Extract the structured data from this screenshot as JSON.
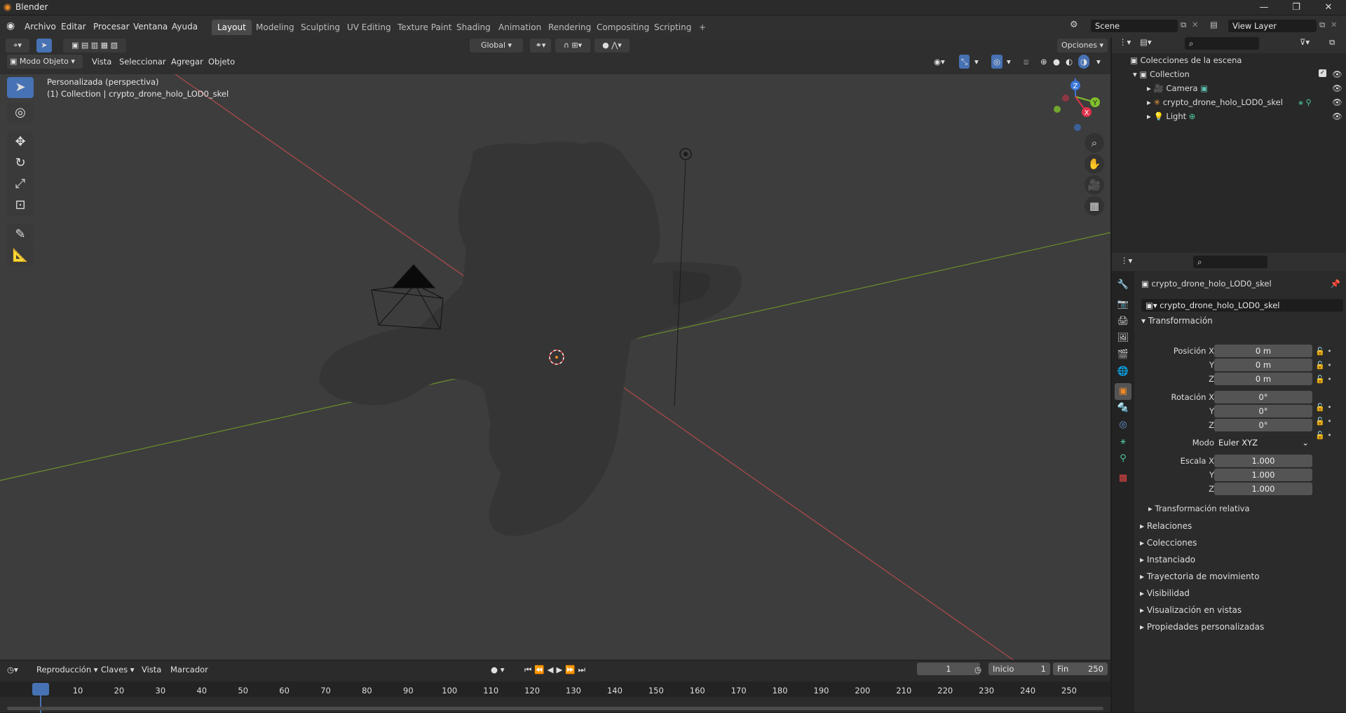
{
  "app": {
    "title": "Blender"
  },
  "window_controls": {
    "minimize": "—",
    "maximize": "❐",
    "close": "✕"
  },
  "menus": [
    "Archivo",
    "Editar",
    "Procesar",
    "Ventana",
    "Ayuda"
  ],
  "workspaces": [
    "Layout",
    "Modeling",
    "Sculpting",
    "UV Editing",
    "Texture Paint",
    "Shading",
    "Animation",
    "Rendering",
    "Compositing",
    "Scripting",
    "+"
  ],
  "active_workspace": "Layout",
  "scene": {
    "name": "Scene",
    "view_layer": "View Layer"
  },
  "viewport_header": {
    "transform_orientation": "Global",
    "options": "Opciones",
    "mode": "Modo Objeto",
    "menus": [
      "Vista",
      "Seleccionar",
      "Agregar",
      "Objeto"
    ]
  },
  "viewport": {
    "view_name": "Personalizada (perspectiva)",
    "context": "(1) Collection | crypto_drone_holo_LOD0_skel",
    "gizmo": {
      "x": "X",
      "y": "Y",
      "z": "Z"
    }
  },
  "outliner": {
    "root": "Colecciones de la escena",
    "collection": "Collection",
    "items": [
      {
        "name": "Camera"
      },
      {
        "name": "crypto_drone_holo_LOD0_skel"
      },
      {
        "name": "Light"
      }
    ]
  },
  "properties": {
    "object_name": "crypto_drone_holo_LOD0_skel",
    "object_field": "crypto_drone_holo_LOD0_skel",
    "transform_title": "Transformación",
    "location_label": "Posición X",
    "rotation_label": "Rotación X",
    "scale_label": "Escala X",
    "y_label": "Y",
    "z_label": "Z",
    "location": [
      "0 m",
      "0 m",
      "0 m"
    ],
    "rotation": [
      "0°",
      "0°",
      "0°"
    ],
    "mode_label": "Modo",
    "mode_value": "Euler XYZ",
    "scale": [
      "1.000",
      "1.000",
      "1.000"
    ],
    "delta": "Transformación relativa",
    "sections": [
      "Relaciones",
      "Colecciones",
      "Instanciado",
      "Trayectoria de movimiento",
      "Visibilidad",
      "Visualización en vistas",
      "Propiedades personalizadas"
    ]
  },
  "timeline": {
    "menus": [
      "Reproducción",
      "Claves",
      "Vista",
      "Marcador"
    ],
    "current_frame": "1",
    "start_label": "Inicio",
    "start": "1",
    "end_label": "Fin",
    "end": "250",
    "ticks": [
      "1",
      "10",
      "20",
      "30",
      "40",
      "50",
      "60",
      "70",
      "80",
      "90",
      "100",
      "110",
      "120",
      "130",
      "140",
      "150",
      "160",
      "170",
      "180",
      "190",
      "200",
      "210",
      "220",
      "230",
      "240",
      "250"
    ]
  },
  "colors": {
    "accent": "#4772b3",
    "x_axis": "#b34a4a",
    "y_axis": "#6a8f2a",
    "active_tab": "#4a4a4a"
  }
}
